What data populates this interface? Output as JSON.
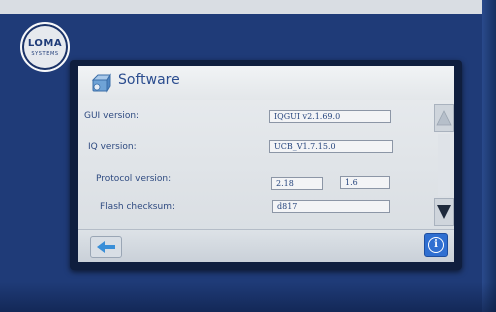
{
  "device": {
    "logo_text": "LOMA",
    "logo_subtext": "SYSTEMS"
  },
  "header": {
    "title": "Software",
    "icon": "software-package-icon"
  },
  "fields": {
    "gui_version": {
      "label": "GUI version:",
      "value": "IQGUI v2.1.69.0"
    },
    "iq_version": {
      "label": "IQ version:",
      "value": "UCB_V1.7.15.0"
    },
    "protocol_version": {
      "label": "Protocol version:",
      "value_1": "2.18",
      "value_2": "1.6"
    },
    "flash_checksum": {
      "label": "Flash checksum:",
      "value": "d817"
    }
  },
  "controls": {
    "scroll_up_icon": "triangle-up-icon",
    "scroll_down_icon": "triangle-down-icon",
    "back_icon": "arrow-left-icon",
    "info_icon": "info-icon",
    "info_glyph": "i"
  },
  "colors": {
    "cabinet": "#1f3b78",
    "title": "#2b4d8f",
    "label": "#2e4a80",
    "info_button": "#2f6fd1",
    "back_arrow": "#3a8fd8"
  }
}
